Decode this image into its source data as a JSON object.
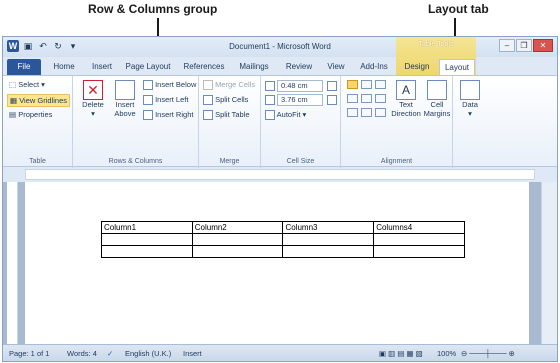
{
  "annotations": {
    "row_columns_group": "Row & Columns group",
    "layout_tab": "Layout tab"
  },
  "window": {
    "title": "Document1 - Microsoft Word",
    "contextual_group": "Table Tools",
    "word_logo": "W"
  },
  "tabs": [
    {
      "label": "File"
    },
    {
      "label": "Home"
    },
    {
      "label": "Insert"
    },
    {
      "label": "Page Layout"
    },
    {
      "label": "References"
    },
    {
      "label": "Mailings"
    },
    {
      "label": "Review"
    },
    {
      "label": "View"
    },
    {
      "label": "Add-Ins"
    },
    {
      "label": "Design"
    },
    {
      "label": "Layout"
    }
  ],
  "ribbon": {
    "table_group": {
      "label": "Table",
      "select": "Select",
      "view_gridlines": "View Gridlines",
      "properties": "Properties"
    },
    "rows_columns_group": {
      "label": "Rows & Columns",
      "delete": "Delete",
      "insert_above_1": "Insert",
      "insert_above_2": "Above",
      "insert_below": "Insert Below",
      "insert_left": "Insert Left",
      "insert_right": "Insert Right"
    },
    "merge_group": {
      "label": "Merge",
      "merge_cells": "Merge Cells",
      "split_cells": "Split Cells",
      "split_table": "Split Table"
    },
    "cell_size_group": {
      "label": "Cell Size",
      "height": "0.48 cm",
      "width": "3.76 cm",
      "autofit": "AutoFit"
    },
    "alignment_group": {
      "label": "Alignment",
      "text_direction_1": "Text",
      "text_direction_2": "Direction",
      "cell_margins_1": "Cell",
      "cell_margins_2": "Margins"
    },
    "data_group": {
      "data": "Data"
    }
  },
  "document": {
    "table": {
      "headers": [
        "Column1",
        "Column2",
        "Column3",
        "Columns4"
      ],
      "rows": [
        [
          "",
          "",
          "",
          ""
        ],
        [
          "",
          "",
          "",
          ""
        ]
      ]
    }
  },
  "status": {
    "page": "Page: 1 of 1",
    "words": "Words: 4",
    "language": "English (U.K.)",
    "mode": "Insert",
    "zoom": "100%"
  }
}
